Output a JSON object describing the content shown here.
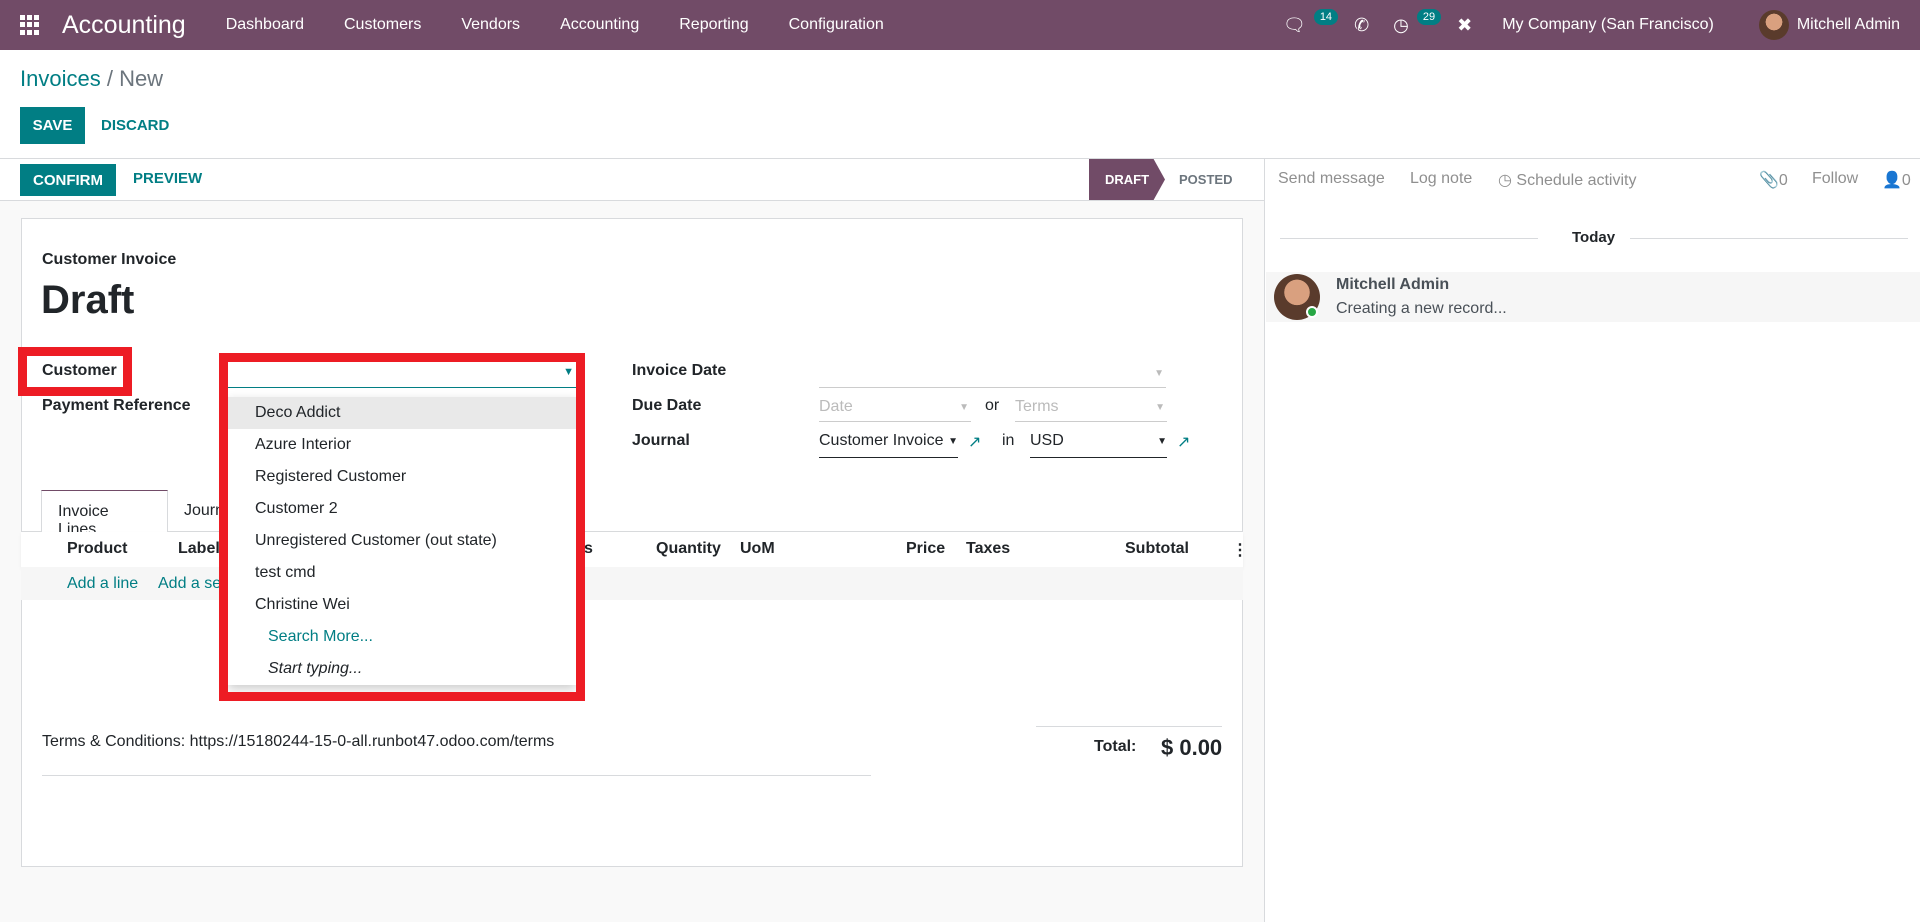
{
  "navbar": {
    "app_name": "Accounting",
    "menu": [
      "Dashboard",
      "Customers",
      "Vendors",
      "Accounting",
      "Reporting",
      "Configuration"
    ],
    "messages_count": "14",
    "activities_count": "29",
    "company": "My Company (San Francisco)",
    "user": "Mitchell Admin",
    "color": "#714b67"
  },
  "breadcrumb": {
    "parent": "Invoices",
    "sep": " / ",
    "current": "New"
  },
  "actions": {
    "save": "SAVE",
    "discard": "DISCARD",
    "confirm": "CONFIRM",
    "preview": "PREVIEW"
  },
  "statusbar": {
    "stages": [
      "DRAFT",
      "POSTED"
    ],
    "active": "DRAFT"
  },
  "form": {
    "type_label": "Customer Invoice",
    "title": "Draft",
    "customer_label": "Customer",
    "payment_ref_label": "Payment Reference",
    "invoice_date_label": "Invoice Date",
    "due_date_label": "Due Date",
    "date_placeholder": "Date",
    "or": "or",
    "terms_placeholder": "Terms",
    "journal_label": "Journal",
    "journal_value": "Customer Invoice",
    "in": "in",
    "currency": "USD"
  },
  "customer_dropdown": {
    "options": [
      "Deco Addict",
      "Azure Interior",
      "Registered Customer",
      "Customer 2",
      "Unregistered Customer (out state)",
      "test cmd",
      "Christine Wei"
    ],
    "search_more": "Search More...",
    "start_typing": "Start typing..."
  },
  "tabs": [
    "Invoice Lines",
    "Journal Items"
  ],
  "table": {
    "columns": [
      "Product",
      "Label",
      "Analytic Tags",
      "Quantity",
      "UoM",
      "Price",
      "Taxes",
      "Subtotal"
    ],
    "add_line": "Add a line",
    "add_section": "Add a section"
  },
  "footer": {
    "terms": "Terms & Conditions: https://15180244-15-0-all.runbot47.odoo.com/terms",
    "total_label": "Total:",
    "total_value": "$ 0.00"
  },
  "chatter": {
    "send_message": "Send message",
    "log_note": "Log note",
    "schedule_activity": "Schedule activity",
    "attachments": "0",
    "follow": "Follow",
    "followers": "0",
    "date_sep": "Today",
    "messages": [
      {
        "author": "Mitchell Admin",
        "body": "Creating a new record..."
      }
    ]
  }
}
